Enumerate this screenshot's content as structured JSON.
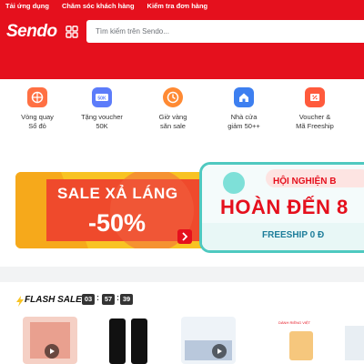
{
  "header": {
    "links": [
      "Tải ứng dụng",
      "Chăm sóc khách hàng",
      "Kiểm tra đơn hàng"
    ],
    "logo": "Sendo",
    "search_placeholder": "Tìm kiếm trên Sendo..."
  },
  "quick_links": [
    {
      "label1": "Vòng quay",
      "label2": "Sổ đỏ",
      "icon": "wheel-icon",
      "color": "#ff7043"
    },
    {
      "label1": "Tặng voucher",
      "label2": "50K",
      "icon": "voucher-icon",
      "color": "#5c7cfa"
    },
    {
      "label1": "Giờ vàng",
      "label2": "săn sale",
      "icon": "clock-icon",
      "color": "#ff8a33"
    },
    {
      "label1": "Nhà cửa",
      "label2": "giảm 50++",
      "icon": "house-icon",
      "color": "#3d7ff0"
    },
    {
      "label1": "Voucher &",
      "label2": "Mã Freeship",
      "icon": "ticket-icon",
      "color": "#ff5a3c"
    }
  ],
  "banner": {
    "left_line1": "SALE XẢ LÁNG",
    "left_line2": "-50%",
    "right_top": "HỘI NGHIỆN B",
    "right_main": "HOÀN ĐẾN 8",
    "right_ship": "FREESHIP 0 Đ"
  },
  "flash_sale": {
    "title": "FLASH SALE",
    "countdown": [
      "03",
      "57",
      "39"
    ],
    "card_text": "DÀNH RIÊNG VIỆT"
  },
  "colors": {
    "brand": "#e5101d",
    "banner_yellow": "#f8c323",
    "banner_teal": "#4fc9c0"
  }
}
